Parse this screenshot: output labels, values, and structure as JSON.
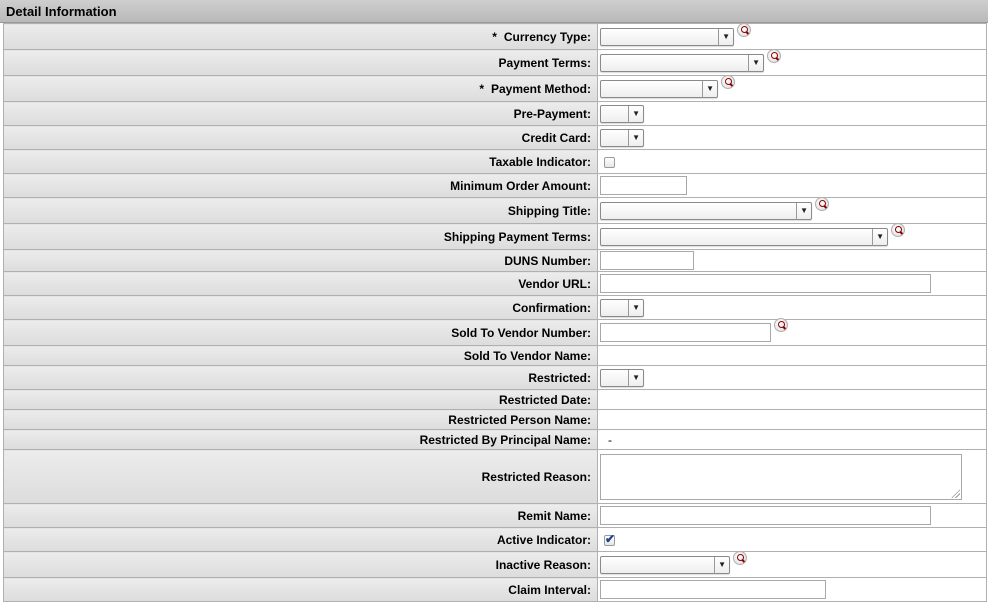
{
  "section": {
    "title": "Detail Information"
  },
  "fields": {
    "currency_type": {
      "label": "Currency Type:",
      "required_mark": "*"
    },
    "payment_terms": {
      "label": "Payment Terms:"
    },
    "payment_method": {
      "label": "Payment Method:",
      "required_mark": "*"
    },
    "pre_payment": {
      "label": "Pre-Payment:"
    },
    "credit_card": {
      "label": "Credit Card:"
    },
    "taxable_indicator": {
      "label": "Taxable Indicator:",
      "checked": false
    },
    "minimum_order_amount": {
      "label": "Minimum Order Amount:",
      "value": ""
    },
    "shipping_title": {
      "label": "Shipping Title:"
    },
    "shipping_payment_terms": {
      "label": "Shipping Payment Terms:"
    },
    "duns_number": {
      "label": "DUNS Number:",
      "value": ""
    },
    "vendor_url": {
      "label": "Vendor URL:",
      "value": ""
    },
    "confirmation": {
      "label": "Confirmation:"
    },
    "sold_to_vendor_number": {
      "label": "Sold To Vendor Number:",
      "value": ""
    },
    "sold_to_vendor_name": {
      "label": "Sold To Vendor Name:",
      "value": ""
    },
    "restricted": {
      "label": "Restricted:"
    },
    "restricted_date": {
      "label": "Restricted Date:",
      "value": ""
    },
    "restricted_person_name": {
      "label": "Restricted Person Name:",
      "value": ""
    },
    "restricted_by_principal_name": {
      "label": "Restricted By Principal Name:",
      "value": "-"
    },
    "restricted_reason": {
      "label": "Restricted Reason:",
      "value": ""
    },
    "remit_name": {
      "label": "Remit Name:",
      "value": ""
    },
    "active_indicator": {
      "label": "Active Indicator:",
      "checked": true
    },
    "inactive_reason": {
      "label": "Inactive Reason:"
    },
    "claim_interval": {
      "label": "Claim Interval:",
      "value": ""
    }
  },
  "icons": {
    "lookup": "magnifier-lookup-icon",
    "dropdown_arrow": "▼"
  }
}
